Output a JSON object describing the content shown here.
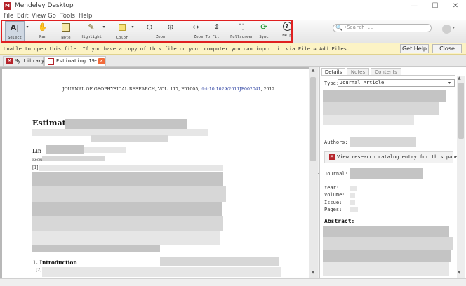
{
  "window": {
    "title": "Mendeley Desktop",
    "logo_text": "M",
    "min_glyph": "—",
    "max_glyph": "☐",
    "close_glyph": "✕"
  },
  "menu": [
    "File",
    "Edit",
    "View",
    "Go",
    "Tools",
    "Help"
  ],
  "toolbar": {
    "tools": [
      {
        "label": "Select",
        "icon": "text-cursor-icon",
        "glyph": "A|"
      },
      {
        "label": "Pan",
        "icon": "hand-icon",
        "glyph": "✋"
      },
      {
        "label": "Note",
        "icon": "note-icon",
        "glyph": "▭"
      },
      {
        "label": "Highlight",
        "icon": "highlighter-icon",
        "glyph": "✎"
      },
      {
        "label": "Color",
        "icon": "color-swatch-icon",
        "glyph": "■"
      },
      {
        "label": "Zoom",
        "icon": "zoom-out-icon",
        "glyph": "⊖"
      },
      {
        "label": "Zoom",
        "icon": "zoom-in-icon",
        "glyph": "⊕"
      },
      {
        "label": "Zoom To Fit",
        "icon": "fit-width-icon",
        "glyph": "↔"
      },
      {
        "label": "Zoom To Fit",
        "icon": "fit-height-icon",
        "glyph": "↕"
      },
      {
        "label": "Fullscreen",
        "icon": "fullscreen-icon",
        "glyph": "⛶"
      },
      {
        "label": "Sync",
        "icon": "sync-icon",
        "glyph": "⟳"
      },
      {
        "label": "Help",
        "icon": "help-icon",
        "glyph": "?"
      }
    ],
    "dropdown_glyph": "▾",
    "search_placeholder": "•Search...",
    "search_glyph": "🔍",
    "highlight_color": "#e02020",
    "swatch_color": "#f7e27a"
  },
  "warning": {
    "text": "Unable to open this file. If you have a copy of this file on your computer you can import it via File → Add Files.",
    "get_help": "Get Help",
    "close": "Close"
  },
  "tabs": [
    {
      "label": "My Library",
      "icon": "library-icon"
    },
    {
      "label": "Estimating 19···",
      "icon": "pdf-icon",
      "close_glyph": "×"
    }
  ],
  "document": {
    "journal_header": "JOURNAL OF GEOPHYSICAL RESEARCH, VOL. 117, F01005, ",
    "doi": "doi:10.1029/2011JF002041",
    "year_suffix": ", 2012",
    "title": "Estimating",
    "author": "Lin",
    "received": "Recei",
    "para1_marker": "[1]",
    "section": "1.   Introduction",
    "para2_marker": "[2]"
  },
  "details": {
    "tabs": [
      "Details",
      "Notes",
      "Contents"
    ],
    "type_label": "Type:",
    "type_value": "Journal Article",
    "authors_label": "Authors:",
    "catalog_button": "View research catalog entry for this paper",
    "journal_label": "Journal:",
    "year_label": "Year:",
    "volume_label": "Volume:",
    "issue_label": "Issue:",
    "pages_label": "Pages:",
    "abstract_label": "Abstract:"
  },
  "scroll_glyphs": {
    "up": "▲",
    "down": "▼",
    "splitter": "◂"
  }
}
